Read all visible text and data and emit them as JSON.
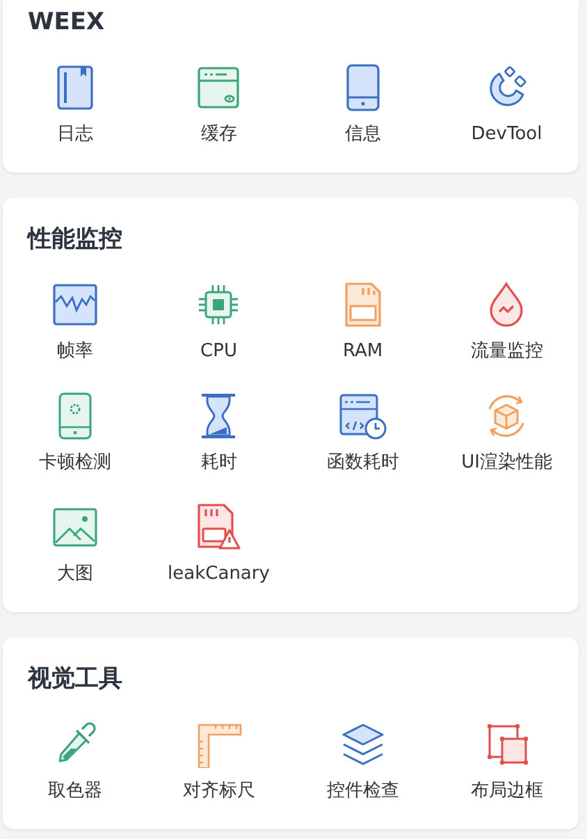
{
  "sections": [
    {
      "title": "WEEX",
      "items": [
        {
          "label": "日志"
        },
        {
          "label": "缓存"
        },
        {
          "label": "信息"
        },
        {
          "label": "DevTool"
        }
      ]
    },
    {
      "title": "性能监控",
      "items": [
        {
          "label": "帧率"
        },
        {
          "label": "CPU"
        },
        {
          "label": "RAM"
        },
        {
          "label": "流量监控"
        },
        {
          "label": "卡顿检测"
        },
        {
          "label": "耗时"
        },
        {
          "label": "函数耗时"
        },
        {
          "label": "UI渲染性能"
        },
        {
          "label": "大图"
        },
        {
          "label": "leakCanary"
        }
      ]
    },
    {
      "title": "视觉工具",
      "items": [
        {
          "label": "取色器"
        },
        {
          "label": "对齐标尺"
        },
        {
          "label": "控件检查"
        },
        {
          "label": "布局边框"
        }
      ]
    }
  ]
}
